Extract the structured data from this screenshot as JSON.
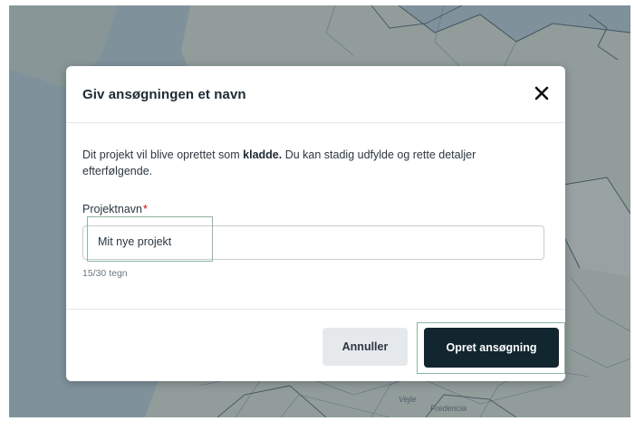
{
  "dialog": {
    "title": "Giv ansøgningen et navn",
    "description_part1": "Dit projekt vil blive oprettet som ",
    "description_bold": "kladde.",
    "description_part2": " Du kan stadig udfylde og rette detaljer efterfølgende.",
    "field_label": "Projektnavn",
    "required_mark": "*",
    "input_value": "Mit nye projekt",
    "char_count": "15/30 tegn",
    "cancel_label": "Annuller",
    "submit_label": "Opret ansøgning",
    "close_icon": "close-icon"
  },
  "map": {
    "labels": [
      "Vejle",
      "Fredericia"
    ]
  },
  "colors": {
    "primary_button": "#12262f",
    "focus_ring": "#8fb59f",
    "required": "#d0021b"
  }
}
